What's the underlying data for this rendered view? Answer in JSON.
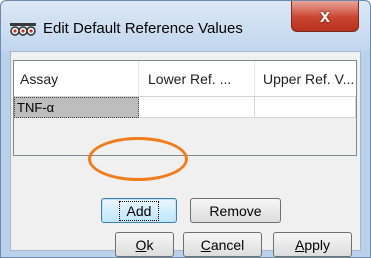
{
  "window": {
    "title": "Edit Default Reference Values",
    "icon": "app-icon",
    "close_glyph": "x"
  },
  "grid": {
    "columns": [
      "Assay",
      "Lower Ref. ...",
      "Upper Ref. V..."
    ],
    "rows": [
      {
        "assay": "TNF-α",
        "lower": "",
        "upper": ""
      }
    ]
  },
  "buttons": {
    "add": "Add",
    "remove": "Remove",
    "ok_mnemonic": "O",
    "ok_rest": "k",
    "cancel_mnemonic": "C",
    "cancel_rest": "ancel",
    "apply_mnemonic": "A",
    "apply_rest": "pply"
  },
  "colors": {
    "highlight": "#f07c1d",
    "close": "#c9452f"
  }
}
